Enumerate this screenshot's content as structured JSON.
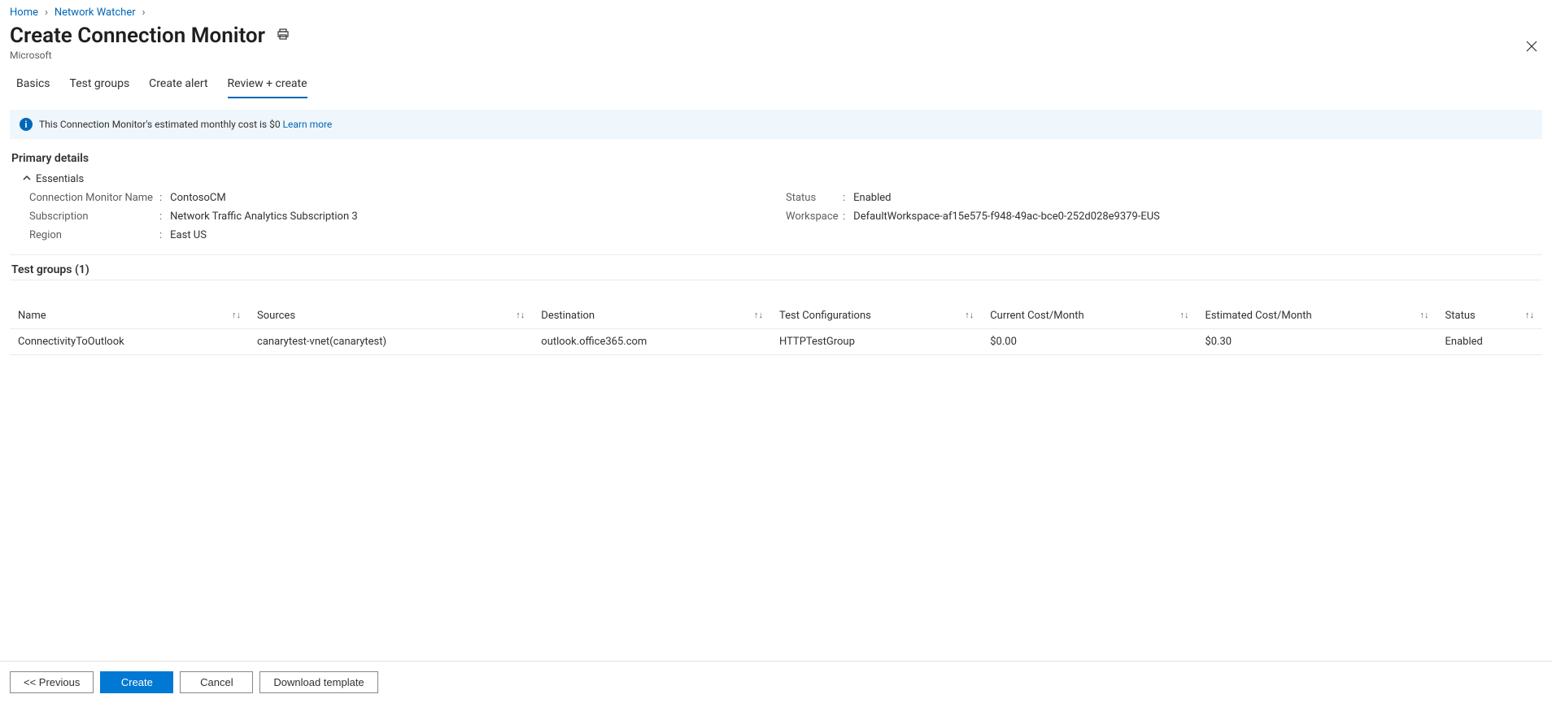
{
  "breadcrumb": {
    "home": "Home",
    "network_watcher": "Network Watcher"
  },
  "header": {
    "title": "Create Connection Monitor",
    "subtitle": "Microsoft"
  },
  "tabs": {
    "basics": "Basics",
    "test_groups": "Test groups",
    "create_alert": "Create alert",
    "review_create": "Review + create"
  },
  "info_bar": {
    "text": "This Connection Monitor's estimated monthly cost is $0 ",
    "link": "Learn more"
  },
  "sections": {
    "primary_details": "Primary details",
    "essentials": "Essentials"
  },
  "details": {
    "connection_monitor_name": {
      "label": "Connection Monitor Name",
      "value": "ContosoCM"
    },
    "subscription": {
      "label": "Subscription",
      "value": "Network Traffic Analytics Subscription 3"
    },
    "region": {
      "label": "Region",
      "value": "East US"
    },
    "status": {
      "label": "Status",
      "value": "Enabled"
    },
    "workspace": {
      "label": "Workspace",
      "value": "DefaultWorkspace-af15e575-f948-49ac-bce0-252d028e9379-EUS"
    }
  },
  "test_groups": {
    "heading": "Test groups (1)",
    "columns": {
      "name": "Name",
      "sources": "Sources",
      "destination": "Destination",
      "test_configurations": "Test Configurations",
      "current_cost": "Current Cost/Month",
      "estimated_cost": "Estimated Cost/Month",
      "status": "Status"
    },
    "rows": [
      {
        "name": "ConnectivityToOutlook",
        "sources": "canarytest-vnet(canarytest)",
        "destination": "outlook.office365.com",
        "test_configurations": "HTTPTestGroup",
        "current_cost": "$0.00",
        "estimated_cost": "$0.30",
        "status": "Enabled"
      }
    ]
  },
  "footer": {
    "previous": "<< Previous",
    "create": "Create",
    "cancel": "Cancel",
    "download_template": "Download template"
  }
}
